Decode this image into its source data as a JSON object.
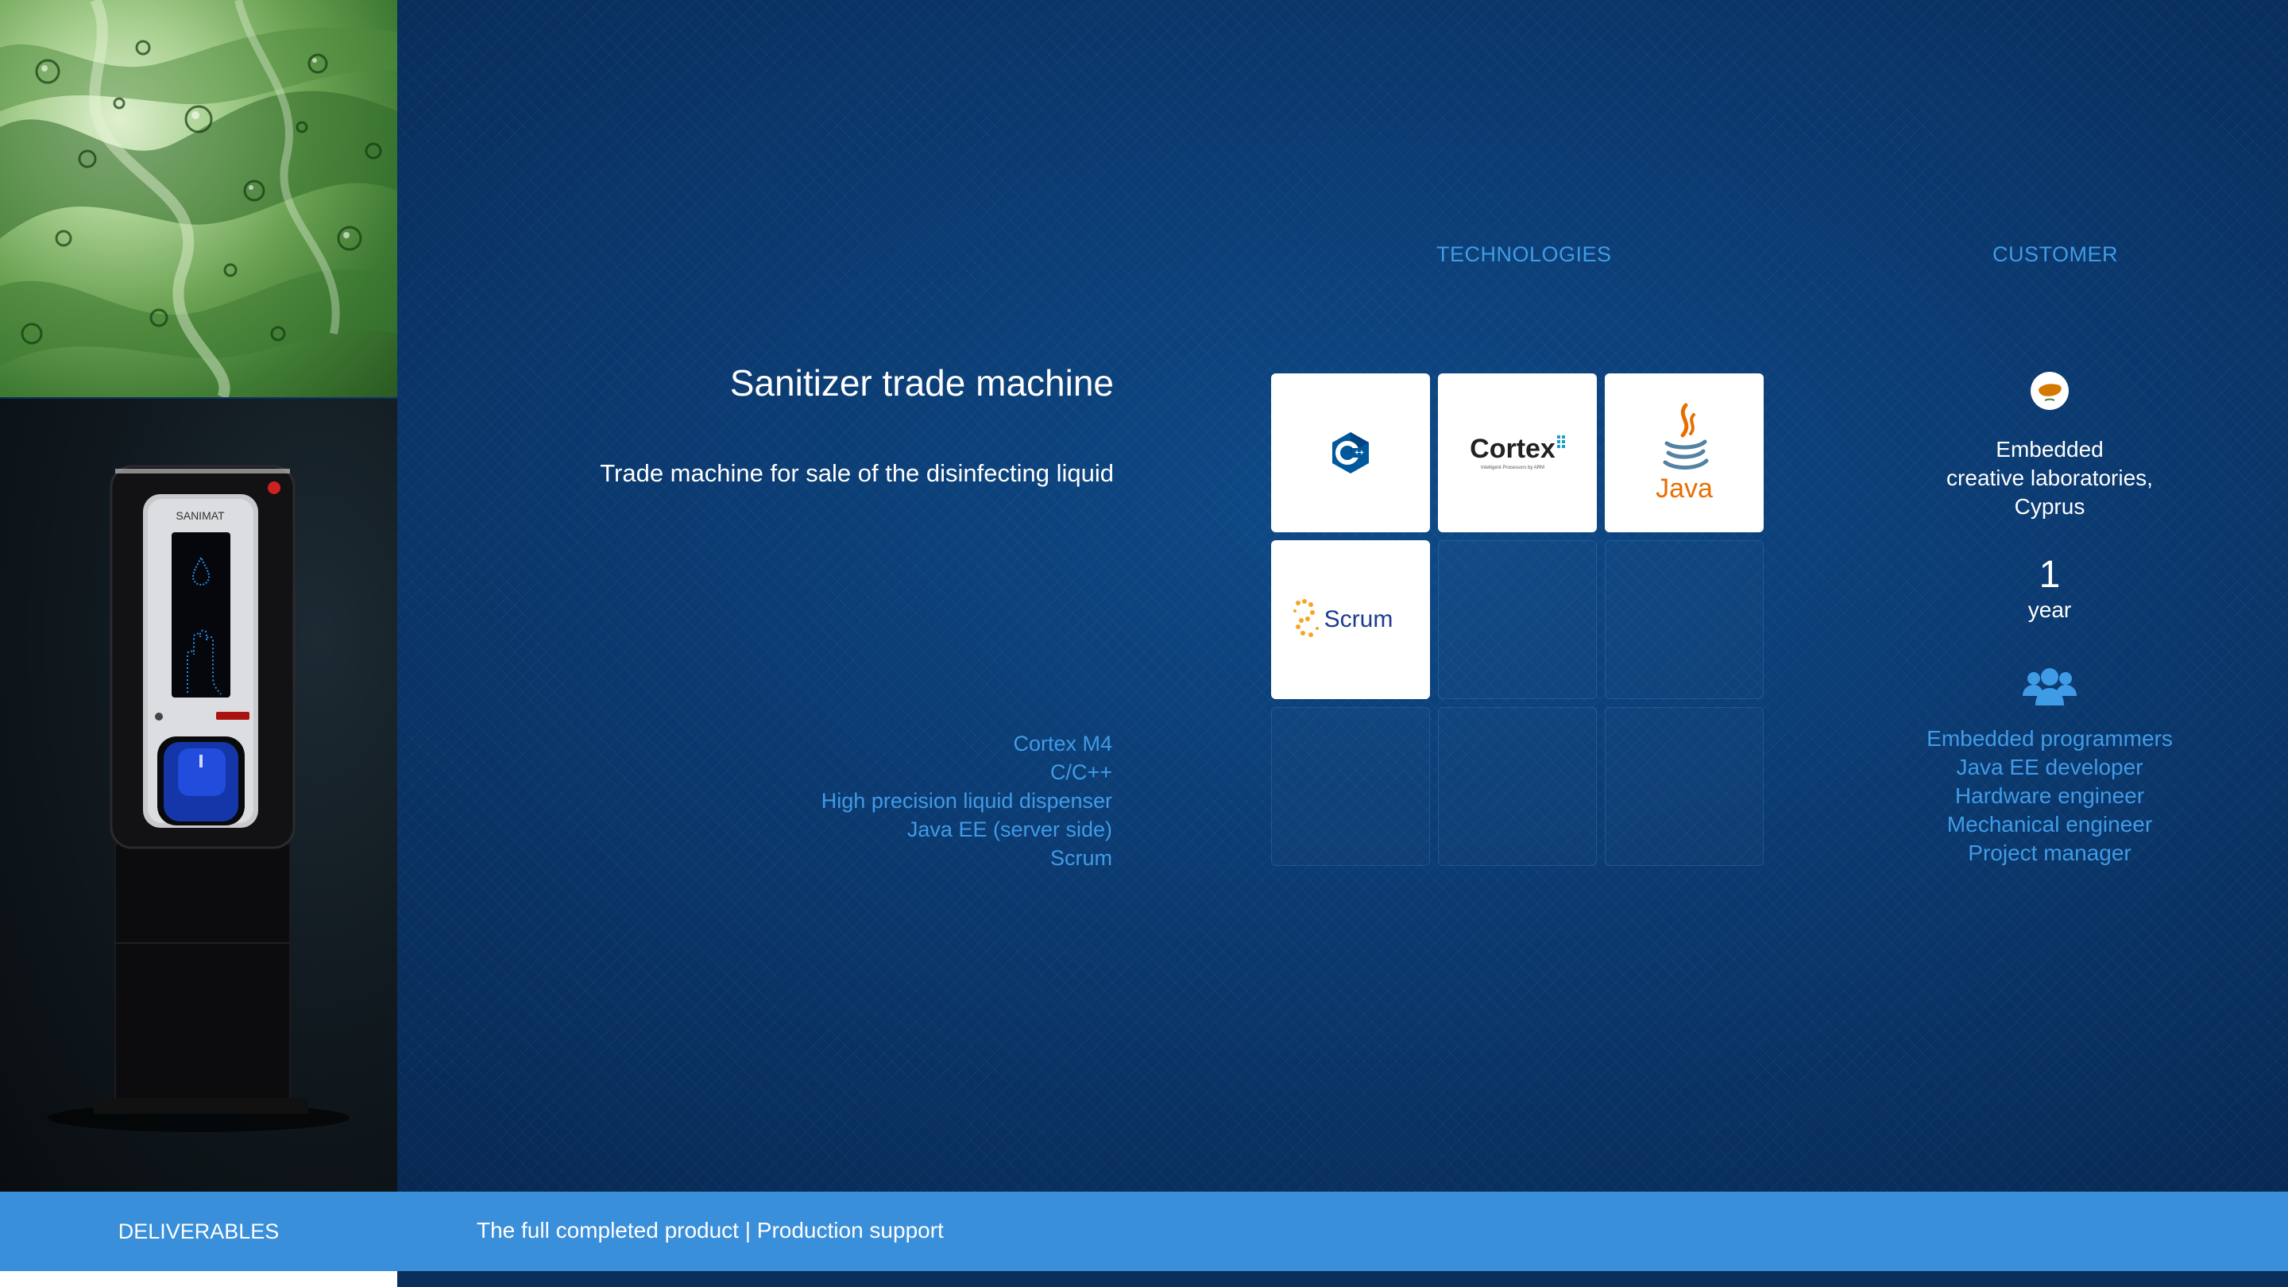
{
  "headers": {
    "technologies": "TECHNOLOGIES",
    "customer": "CUSTOMER"
  },
  "project": {
    "title": "Sanitizer trade machine",
    "subtitle": "Trade machine for sale of the disinfecting liquid"
  },
  "tech_list": [
    "Cortex M4",
    "C/C++",
    "High precision liquid dispenser",
    "Java EE (server side)",
    "Scrum"
  ],
  "machine_brand": "SANIMAT",
  "tiles": [
    {
      "name": "cpp-logo",
      "label": "C++"
    },
    {
      "name": "cortex-logo",
      "label": "Cortex",
      "sub": "Intelligent Processors by ARM"
    },
    {
      "name": "java-logo",
      "label": "Java"
    },
    {
      "name": "scrum-logo",
      "label": "Scrum"
    }
  ],
  "customer": {
    "name_lines": [
      "Embedded",
      "creative laboratories,",
      "Cyprus"
    ],
    "duration_value": "1",
    "duration_unit": "year",
    "team": [
      "Embedded  programmers",
      "Java EE developer",
      "Hardware engineer",
      "Mechanical engineer",
      "Project manager"
    ]
  },
  "footer": {
    "label": "DELIVERABLES",
    "text": "The full completed product  |  Production support"
  },
  "colors": {
    "accent_blue": "#3f9be6",
    "footer_bar": "#3a8fdb",
    "background": "#0b3b72",
    "java_orange": "#e76f00",
    "cpp_blue": "#00599c",
    "scrum_orange": "#f5a623",
    "scrum_text": "#1e3c8c"
  },
  "icons": {
    "customer_flag": "cyprus-flag-icon",
    "team": "team-group-icon"
  }
}
